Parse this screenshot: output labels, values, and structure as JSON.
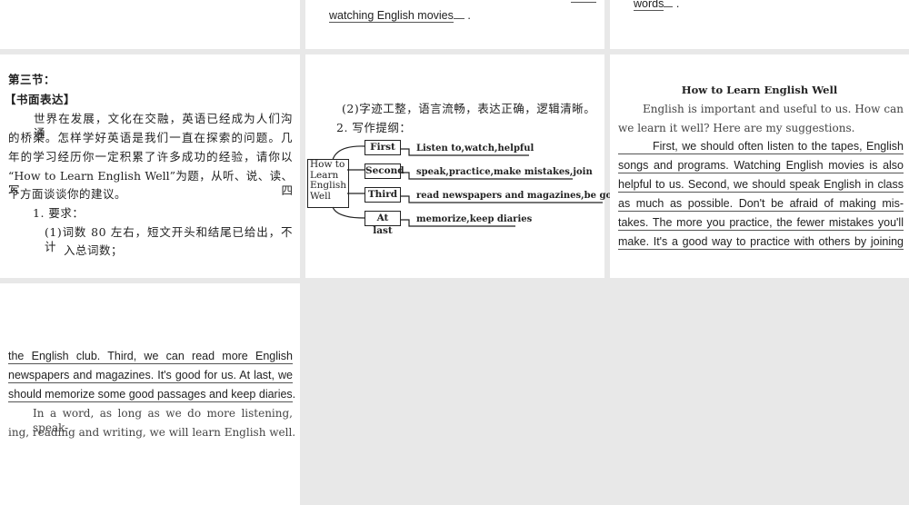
{
  "top": {
    "middle_line": "watching English movies",
    "middle_end": ".",
    "right_line": "words",
    "right_end": "."
  },
  "left": {
    "section": "第三节：",
    "heading": "【书面表达】",
    "para": [
      "世界在发展，文化在交融，英语已经成为人们沟通",
      "的桥梁。怎样学好英语是我们一直在探索的问题。几",
      "年的学习经历你一定积累了许多成功的经验，请你以",
      "“How to Learn English Well”为题，从听、说、读、写四",
      "个方面谈谈你的建议。"
    ],
    "req_title": "1. 要求：",
    "req1": "(1)词数 80 左右，短文开头和结尾已给出，不计",
    "req1b": "入总词数；"
  },
  "middle": {
    "req2": "(2)字迹工整，语言流畅，表达正确，逻辑清晰。",
    "outline_title": "2. 写作提纲：",
    "root": [
      "How to",
      "Learn",
      "English",
      "Well"
    ],
    "branches": [
      {
        "label": "First",
        "hint": "Listen to,watch,helpful"
      },
      {
        "label": "Second",
        "hint": "speak,practice,make mistakes,join"
      },
      {
        "label": "Third",
        "hint": "read newspapers and magazines,be good for"
      },
      {
        "label": "At last",
        "hint": "memorize,keep diaries"
      }
    ]
  },
  "right": {
    "title": "How to Learn English Well",
    "intro": [
      "English is important and useful to us. How can",
      "we learn it well?  Here are my suggestions."
    ],
    "answer": [
      "First, we should often listen to the tapes, English",
      "songs and programs. Watching English movies is also",
      "helpful to us. Second, we should speak English in class",
      "as much as possible. Don't be afraid of making mis-",
      "takes. The more you practice, the fewer mistakes you'll",
      "make. It's a good way to practice with others by joining"
    ]
  },
  "bottom": {
    "answer": [
      "the English club. Third, we can read more English",
      "newspapers and magazines. It's good for us. At last, we",
      "should memorize some good passages and keep diaries."
    ],
    "ending": [
      "In a word, as long as we do more listening, speak-",
      "ing, reading and writing, we will learn English well."
    ]
  }
}
